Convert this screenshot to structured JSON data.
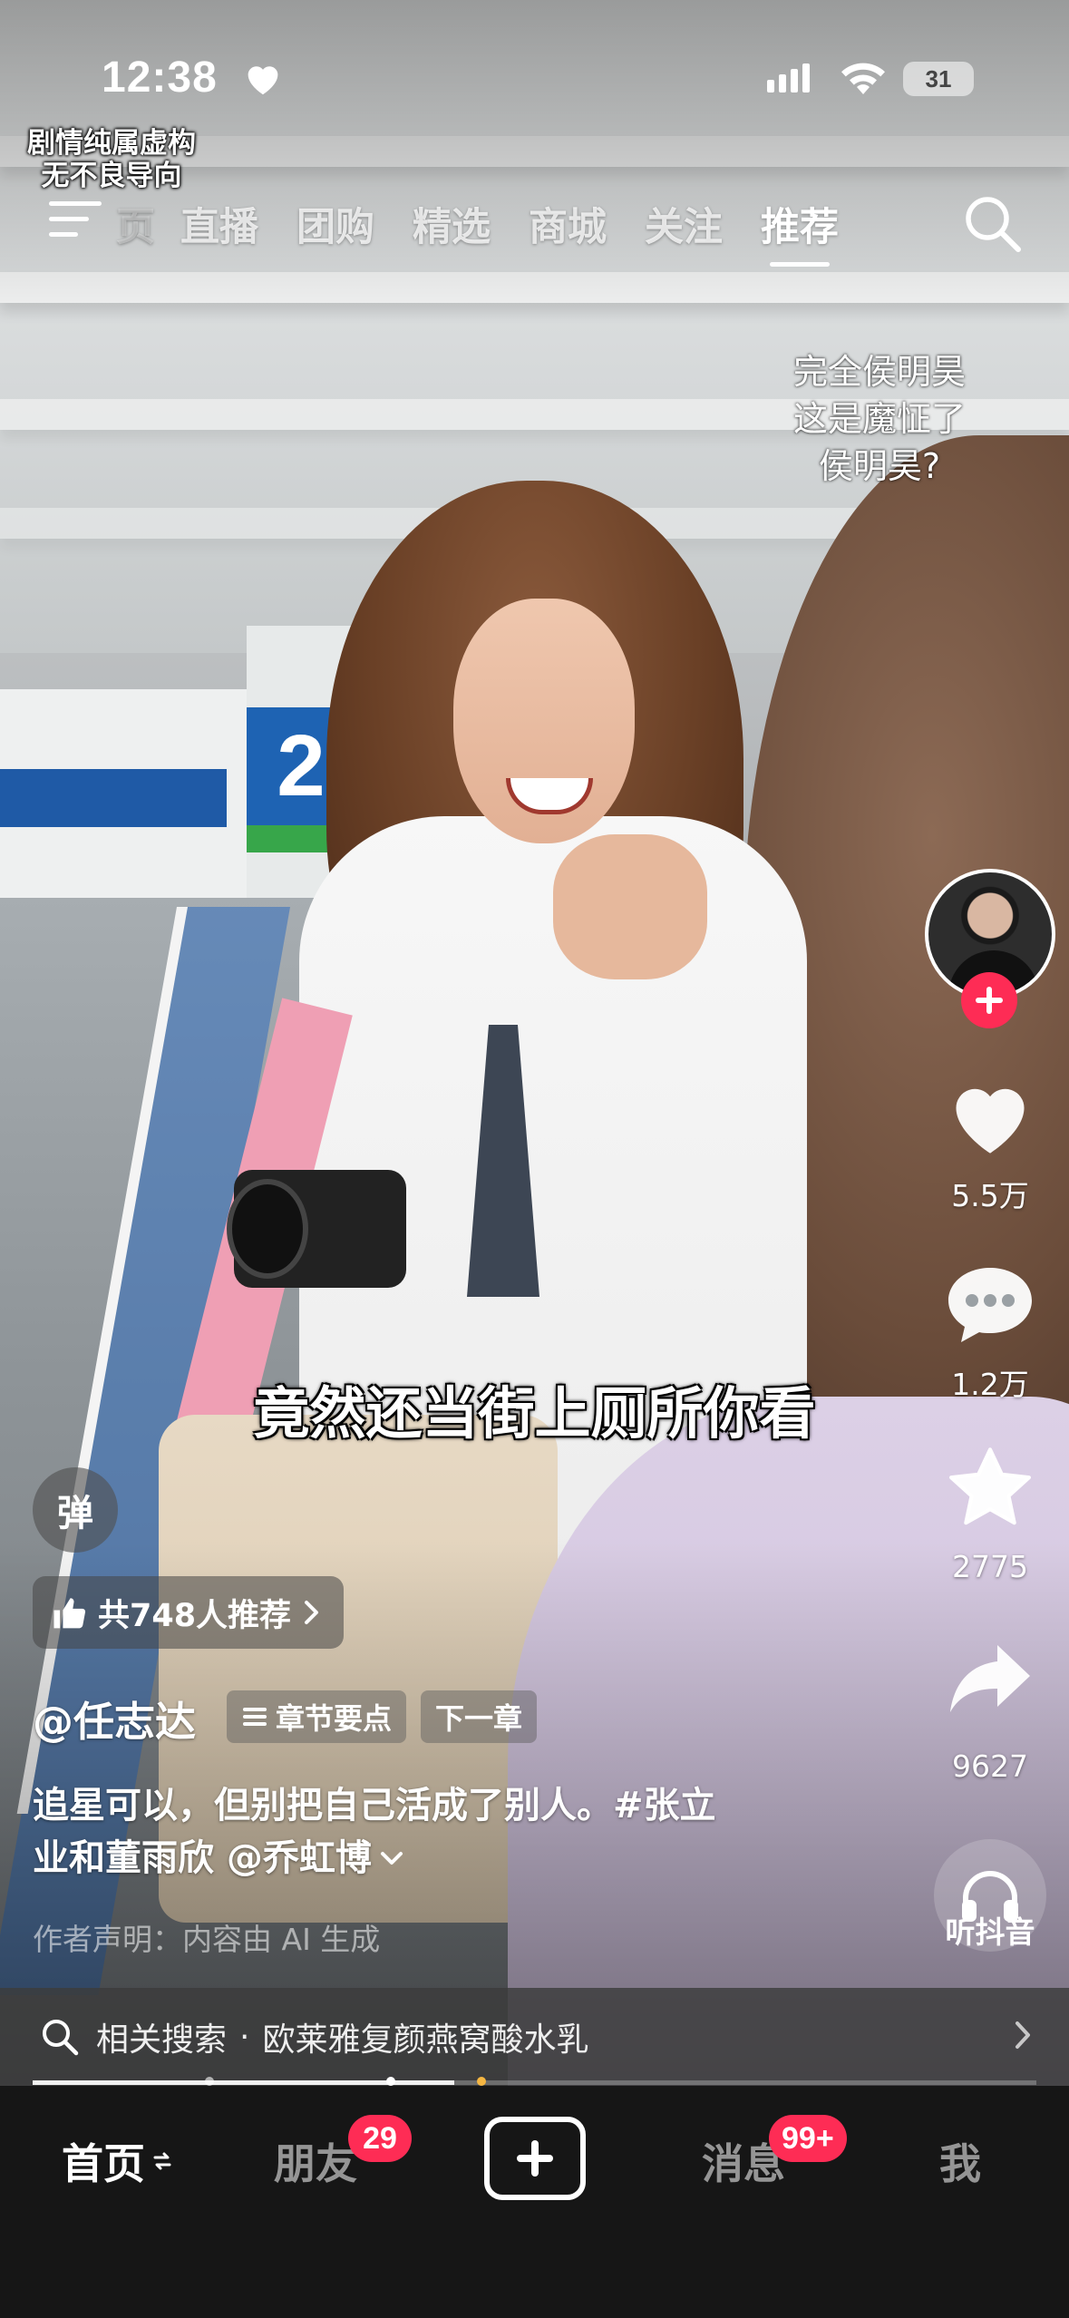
{
  "status_bar": {
    "time": "12:38",
    "battery": "31"
  },
  "disclaimer": {
    "line1": "剧情纯属虚构",
    "line2": "无不良导向"
  },
  "top_nav": {
    "tabs": [
      {
        "label": "页",
        "faded": true
      },
      {
        "label": "直播"
      },
      {
        "label": "团购"
      },
      {
        "label": "精选"
      },
      {
        "label": "商城"
      },
      {
        "label": "关注"
      },
      {
        "label": "推荐",
        "active": true
      }
    ]
  },
  "floating_caption": {
    "line1": "完全侯明昊",
    "line2": "这是魔怔了",
    "line3": "侯明昊?"
  },
  "right_rail": {
    "likes": "5.5万",
    "comments": "1.2万",
    "favorites": "2775",
    "shares": "9627",
    "listen_label": "听抖音"
  },
  "subtitle": "竟然还当街上厕所你看",
  "danmu_label": "弹",
  "recommend": {
    "text": "共748人推荐"
  },
  "author": "@任志达",
  "chapter": {
    "points": "章节要点",
    "next": "下一章"
  },
  "description": {
    "line1": "追星可以，但别把自己活成了别人。#张立",
    "line2": "业和董雨欣 @乔虹博"
  },
  "ai_note": "作者声明：内容由 AI 生成",
  "related_search": {
    "prefix": "相关搜索",
    "dot": "·",
    "term": "欧莱雅复颜燕窝酸水乳"
  },
  "progress": {
    "fraction": 0.42
  },
  "tab_bar": {
    "home": "首页",
    "friends": "朋友",
    "friends_badge": "29",
    "messages": "消息",
    "messages_badge": "99+",
    "me": "我"
  },
  "colors": {
    "accent": "#fe2c55",
    "tabbar_bg": "#161616"
  }
}
